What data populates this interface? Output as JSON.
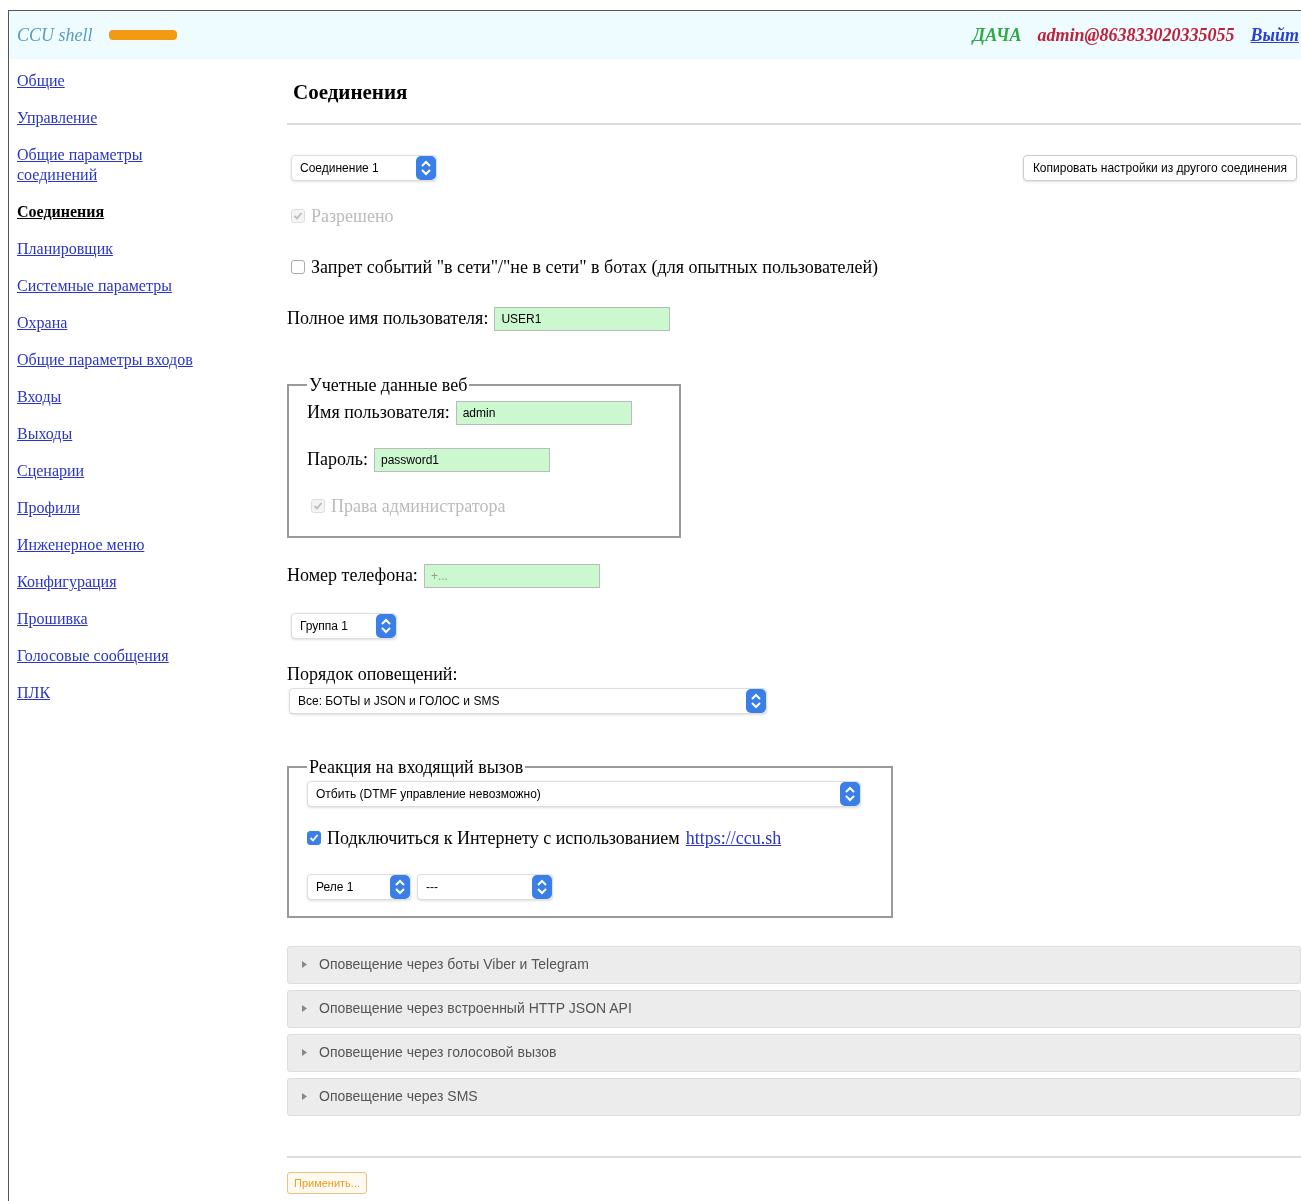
{
  "header": {
    "brand": "CCU shell",
    "site": "ДАЧА",
    "account": "admin@863833020335055",
    "logout": "Выйт"
  },
  "sidebar": {
    "items": [
      {
        "label": "Общие",
        "selected": false
      },
      {
        "label": "Управление",
        "selected": false
      },
      {
        "label": "Общие параметры соединений",
        "selected": false
      },
      {
        "label": "Соединения",
        "selected": true
      },
      {
        "label": "Планировщик",
        "selected": false
      },
      {
        "label": "Системные параметры",
        "selected": false
      },
      {
        "label": "Охрана",
        "selected": false
      },
      {
        "label": "Общие параметры входов",
        "selected": false
      },
      {
        "label": "Входы",
        "selected": false
      },
      {
        "label": "Выходы",
        "selected": false
      },
      {
        "label": "Сценарии",
        "selected": false
      },
      {
        "label": "Профили",
        "selected": false
      },
      {
        "label": "Инженерное меню",
        "selected": false
      },
      {
        "label": "Конфигурация",
        "selected": false
      },
      {
        "label": "Прошивка",
        "selected": false
      },
      {
        "label": "Голосовые сообщения",
        "selected": false
      },
      {
        "label": "ПЛК",
        "selected": false
      }
    ]
  },
  "page_title": "Соединения",
  "connection_select": {
    "value": "Соединение 1"
  },
  "copy_button": "Копировать настройки из другого соединения",
  "enabled": {
    "label": "Разрешено",
    "checked": true,
    "disabled": true
  },
  "ban_events": {
    "label": "Запрет событий \"в сети\"/\"не в сети\" в ботах (для опытных пользователей)",
    "checked": false,
    "disabled": false
  },
  "full_name": {
    "label": "Полное имя пользователя:",
    "value": "USER1"
  },
  "web_credentials": {
    "legend": "Учетные данные веб",
    "username": {
      "label": "Имя пользователя:",
      "value": "admin"
    },
    "password": {
      "label": "Пароль:",
      "value": "password1"
    },
    "admin_rights": {
      "label": "Права администратора",
      "checked": true,
      "disabled": true
    }
  },
  "phone": {
    "label": "Номер телефона:",
    "placeholder": "+..."
  },
  "group_select": {
    "value": "Группа 1"
  },
  "notify_order": {
    "label": "Порядок оповещений:",
    "value": "Все: БОТЫ и JSON и ГОЛОС и SMS"
  },
  "incoming_call": {
    "legend": "Реакция на входящий вызов",
    "action_select": {
      "value": "Отбить (DTMF управление невозможно)"
    },
    "internet": {
      "label": "Подключиться к Интернету с использованием",
      "link": "https://ccu.sh",
      "checked": true,
      "disabled": false
    },
    "relay_select": {
      "value": "Реле 1"
    },
    "relay_mode_select": {
      "value": "---"
    }
  },
  "sections": [
    {
      "title": "Оповещение через боты Viber и Telegram",
      "expanded": false
    },
    {
      "title": "Оповещение через встроенный HTTP JSON API",
      "expanded": false
    },
    {
      "title": "Оповещение через голосовой вызов",
      "expanded": false
    },
    {
      "title": "Оповещение через SMS",
      "expanded": false
    }
  ],
  "apply_button": "Применить..."
}
